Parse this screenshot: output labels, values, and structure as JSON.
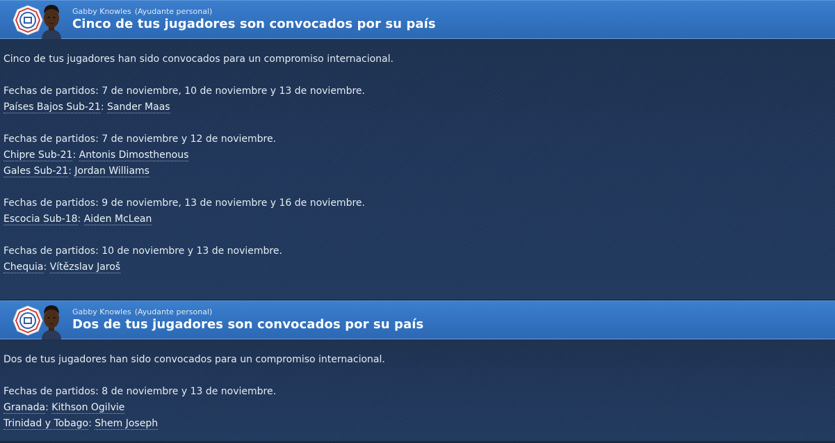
{
  "messages": [
    {
      "sender_name": "Gabby Knowles",
      "sender_role": "(Ayudante personal)",
      "subject": "Cinco de tus jugadores son convocados por su país",
      "intro": "Cinco de tus jugadores han sido convocados para un compromiso internacional.",
      "groups": [
        {
          "dates": "Fechas de partidos: 7 de noviembre, 10 de noviembre y 13 de noviembre.",
          "callups": [
            {
              "team": "Países Bajos Sub-21",
              "player": "Sander Maas"
            }
          ]
        },
        {
          "dates": "Fechas de partidos: 7 de noviembre y 12 de noviembre.",
          "callups": [
            {
              "team": "Chipre Sub-21",
              "player": "Antonis Dimosthenous"
            },
            {
              "team": "Gales Sub-21",
              "player": "Jordan Williams"
            }
          ]
        },
        {
          "dates": "Fechas de partidos: 9 de noviembre, 13 de noviembre y 16 de noviembre.",
          "callups": [
            {
              "team": "Escocia Sub-18",
              "player": "Aiden McLean"
            }
          ]
        },
        {
          "dates": "Fechas de partidos: 10 de noviembre y 13 de noviembre.",
          "callups": [
            {
              "team": "Chequia",
              "player": "Vítězslav Jaroš"
            }
          ]
        }
      ]
    },
    {
      "sender_name": "Gabby Knowles",
      "sender_role": "(Ayudante personal)",
      "subject": "Dos de tus jugadores son convocados por su país",
      "intro": "Dos de tus jugadores han sido convocados para un compromiso internacional.",
      "groups": [
        {
          "dates": "Fechas de partidos: 8 de noviembre y 13 de noviembre.",
          "callups": [
            {
              "team": "Granada",
              "player": "Kithson Ogilvie"
            },
            {
              "team": "Trinidad y Tobago",
              "player": "Shem Joseph"
            }
          ]
        }
      ]
    }
  ],
  "separator": ":",
  "colors": {
    "header_blue": "#3272c0",
    "body_navy": "#1f3456",
    "text": "#e4ebf4"
  },
  "icons": {
    "club_crest": "club-crest-icon",
    "staff_avatar": "staff-avatar"
  }
}
